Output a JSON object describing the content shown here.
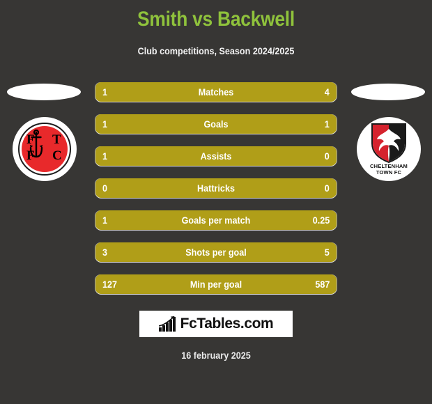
{
  "header": {
    "title": "Smith vs Backwell",
    "subtitle": "Club competitions, Season 2024/2025",
    "title_color": "#8fc23c",
    "subtitle_color": "#f2f2f2"
  },
  "theme": {
    "background": "#373634",
    "bar_fill": "#b09e18",
    "bar_text": "#ffffff"
  },
  "teams": {
    "home": {
      "crest_name": "fleetwood-town-fc-crest",
      "crest_letters": [
        "F",
        "T",
        "F",
        "C"
      ],
      "crest_colors": {
        "primary": "#e8292b",
        "secondary": "#000000",
        "background": "#ffffff"
      }
    },
    "away": {
      "crest_name": "cheltenham-town-fc-crest",
      "crest_caption_line1": "CHELTENHAM",
      "crest_caption_line2": "TOWN FC",
      "crest_colors": {
        "primary": "#d5232e",
        "secondary": "#1a1a1a",
        "background": "#ffffff"
      }
    }
  },
  "stats": [
    {
      "label": "Matches",
      "home": "1",
      "away": "4"
    },
    {
      "label": "Goals",
      "home": "1",
      "away": "1"
    },
    {
      "label": "Assists",
      "home": "1",
      "away": "0"
    },
    {
      "label": "Hattricks",
      "home": "0",
      "away": "0"
    },
    {
      "label": "Goals per match",
      "home": "1",
      "away": "0.25"
    },
    {
      "label": "Shots per goal",
      "home": "3",
      "away": "5"
    },
    {
      "label": "Min per goal",
      "home": "127",
      "away": "587"
    }
  ],
  "footer": {
    "logo_text": "FcTables.com",
    "logo_icon": "bar-chart-growth-icon",
    "date": "16 february 2025"
  }
}
